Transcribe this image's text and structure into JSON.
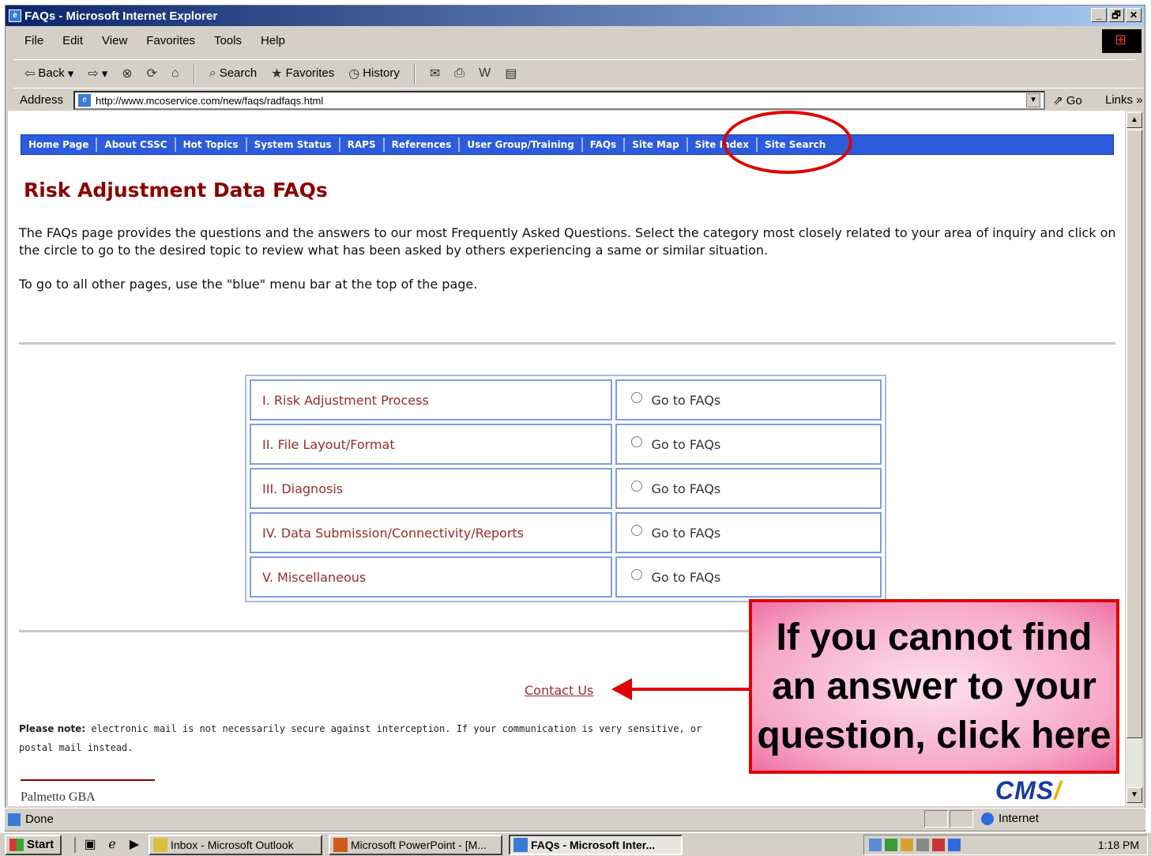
{
  "window": {
    "title": "FAQs - Microsoft Internet Explorer",
    "buttons": [
      "_",
      "🗗",
      "✕"
    ]
  },
  "menu": [
    "File",
    "Edit",
    "View",
    "Favorites",
    "Tools",
    "Help"
  ],
  "toolbar": {
    "back": "Back",
    "search": "Search",
    "favorites": "Favorites",
    "history": "History"
  },
  "address": {
    "label": "Address",
    "url": "http://www.mcoservice.com/new/faqs/radfaqs.html",
    "go": "Go",
    "links": "Links"
  },
  "nav": [
    "Home Page",
    "About CSSC",
    "Hot Topics",
    "System Status",
    "RAPS",
    "References",
    "User Group/Training",
    "FAQs",
    "Site Map",
    "Site Index",
    "Site Search"
  ],
  "page": {
    "title": "Risk Adjustment Data FAQs",
    "intro": "The FAQs page provides the questions and the answers to our most Frequently Asked Questions. Select the category most closely related to your area of inquiry and click on the circle to go to the desired topic to review what has been asked by others experiencing a same or similar situation.",
    "intro2": "To go to all other pages, use the \"blue\" menu bar at the top of the page.",
    "contact": "Contact Us",
    "note_label": "Please note:",
    "note_text": "electronic mail is not necessarily secure against interception. If your communication is very sensitive, or",
    "note_text2": "postal mail instead.",
    "logo_left": "Palmetto GBA",
    "logo_cms": "CMS"
  },
  "faqs": [
    {
      "category": "I. Risk Adjustment Process",
      "action": "Go to FAQs"
    },
    {
      "category": "II. File Layout/Format",
      "action": "Go to FAQs"
    },
    {
      "category": "III. Diagnosis",
      "action": "Go to FAQs"
    },
    {
      "category": "IV. Data Submission/Connectivity/Reports",
      "action": "Go to FAQs"
    },
    {
      "category": "V. Miscellaneous",
      "action": "Go to FAQs"
    }
  ],
  "callout": {
    "line1": "If you cannot find",
    "line2": "an answer to your",
    "line3": "question, click here"
  },
  "status": {
    "text": "Done",
    "zone": "Internet"
  },
  "taskbar": {
    "start": "Start",
    "tasks": [
      "Inbox - Microsoft Outlook",
      "Microsoft PowerPoint - [M...",
      "FAQs - Microsoft Inter..."
    ],
    "clock": "1:18 PM"
  },
  "colors": {
    "nav_blue": "#2c5bdc",
    "title_red": "#8b0000",
    "highlight_red": "#e00000",
    "callout_pink": "#f6a8c6"
  }
}
